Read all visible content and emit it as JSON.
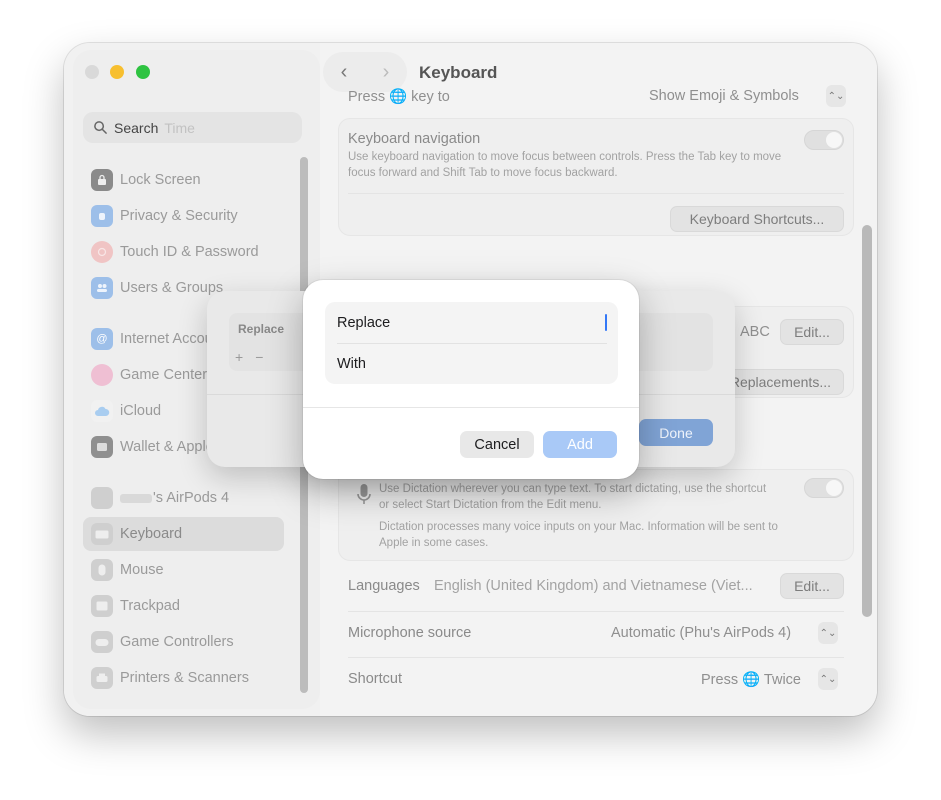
{
  "window": {
    "title": "Keyboard"
  },
  "sidebar": {
    "search_label": "Search",
    "search_ghost": "Time",
    "items": [
      {
        "label": "Lock Screen",
        "icon": "lock-icon",
        "color": "#5e5e5e"
      },
      {
        "label": "Privacy & Security",
        "icon": "hand-icon",
        "color": "#3b82f6"
      },
      {
        "label": "Touch ID & Password",
        "icon": "fingerprint-icon",
        "color": "#ef5b5b"
      },
      {
        "label": "Users & Groups",
        "icon": "users-icon",
        "color": "#3b82f6"
      },
      {
        "label": "Internet Accounts",
        "icon": "at-icon",
        "color": "#3b82f6"
      },
      {
        "label": "Game Center",
        "icon": "game-center-icon",
        "color": "#e76fa0"
      },
      {
        "label": "iCloud",
        "icon": "cloud-icon",
        "color": "#5aa9f0"
      },
      {
        "label": "Wallet & Apple Pay",
        "icon": "wallet-icon",
        "color": "#3d3d3d"
      },
      {
        "label": "'s AirPods 4",
        "icon": "airpods-icon",
        "color": "#9a9a9a"
      },
      {
        "label": "Keyboard",
        "icon": "keyboard-icon",
        "color": "#8a8a8a"
      },
      {
        "label": "Mouse",
        "icon": "mouse-icon",
        "color": "#8a8a8a"
      },
      {
        "label": "Trackpad",
        "icon": "trackpad-icon",
        "color": "#8a8a8a"
      },
      {
        "label": "Game Controllers",
        "icon": "gamepad-icon",
        "color": "#8a8a8a"
      },
      {
        "label": "Printers & Scanners",
        "icon": "printer-icon",
        "color": "#8a8a8a"
      }
    ]
  },
  "content": {
    "press_key_label": "Press 🌐 key to",
    "press_key_value": "Show Emoji & Symbols",
    "kbnav_title": "Keyboard navigation",
    "kbnav_desc": "Use keyboard navigation to move focus between controls. Press the Tab key to move focus forward and Shift Tab to move focus backward.",
    "shortcuts_button": "Keyboard Shortcuts...",
    "input_value": "ABC",
    "edit_button": "Edit...",
    "replacements_button": "Text Replacements...",
    "dictation_desc_1": "Use Dictation wherever you can type text. To start dictating, use the shortcut or select Start Dictation from the Edit menu.",
    "dictation_desc_2": "Dictation processes many voice inputs on your Mac. Information will be sent to Apple in some cases.",
    "languages_label": "Languages",
    "languages_value": "English (United Kingdom) and Vietnamese (Viet...",
    "languages_edit": "Edit...",
    "mic_label": "Microphone source",
    "mic_value": "Automatic (Phu's AirPods 4)",
    "shortcut_label": "Shortcut",
    "shortcut_value": "Press 🌐 Twice"
  },
  "sheet": {
    "column_header": "Replace",
    "plus": "+",
    "minus": "−",
    "done_label": "Done"
  },
  "dialog": {
    "replace_label": "Replace",
    "with_label": "With",
    "cancel_label": "Cancel",
    "add_label": "Add"
  }
}
